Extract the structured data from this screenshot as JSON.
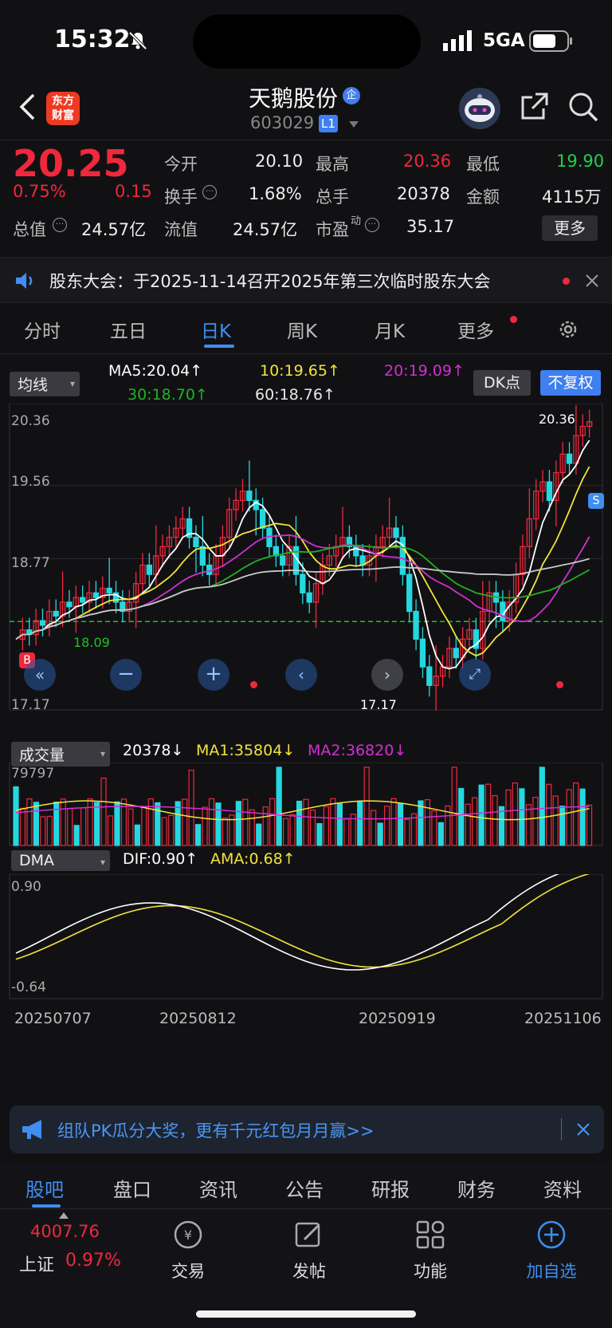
{
  "status_bar": {
    "time": "15:32",
    "network": "5GA"
  },
  "header": {
    "logo_line1": "东方",
    "logo_line2": "财富",
    "stock_name": "天鹅股份",
    "name_badge": "企",
    "stock_code": "603029",
    "level": "L1"
  },
  "quote": {
    "price": "20.25",
    "change_pct": "0.75%",
    "change_amt": "0.15",
    "open_label": "今开",
    "open": "20.10",
    "high_label": "最高",
    "high": "20.36",
    "low_label": "最低",
    "low": "19.90",
    "turnover_label": "换手",
    "turnover": "1.68%",
    "volume_label": "总手",
    "volume": "20378",
    "amount_label": "金额",
    "amount": "4115万",
    "mktcap_label": "总值",
    "mktcap": "24.57亿",
    "float_label": "流值",
    "float_cap": "24.57亿",
    "pe_label": "市盈",
    "pe_sup": "动",
    "pe": "35.17",
    "more_button": "更多"
  },
  "notice": {
    "text": "股东大会：于2025-11-14召开2025年第三次临时股东大会"
  },
  "period_tabs": [
    "分时",
    "五日",
    "日K",
    "周K",
    "月K",
    "更多"
  ],
  "active_tab_index": 2,
  "indicators": {
    "main_select": "均线",
    "ma5": "MA5:20.04↑",
    "ma10": "10:19.65↑",
    "ma20": "20:19.09↑",
    "ma30": "30:18.70↑",
    "ma60": "60:18.76↑",
    "dk_button": "DK点",
    "fq_button": "不复权"
  },
  "colors": {
    "up": "#f0283c",
    "down": "#25d8e0",
    "ma5": "#ffffff",
    "ma10": "#f2e33c",
    "ma20": "#d22fd2",
    "ma30": "#22b022",
    "ma60": "#c8c8c8",
    "accent": "#3f8ef0"
  },
  "chart_data": [
    {
      "type": "candlestick",
      "title": "日K",
      "yticks": [
        "20.36",
        "19.56",
        "18.77",
        "17.17"
      ],
      "ylim": [
        17.17,
        20.36
      ],
      "max_label": "20.36",
      "min_label": "17.17",
      "cost_line_value": "18.09",
      "buy_marker": "B",
      "sell_marker": "S",
      "xticks": [
        "20250707",
        "20250812",
        "20250919",
        "20251106"
      ],
      "ma_legend": [
        "MA5:20.04↑",
        "10:19.65↑",
        "20:19.09↑",
        "30:18.70↑",
        "60:18.76↑"
      ]
    },
    {
      "type": "bar",
      "title": "成交量",
      "ymax_label": "79797",
      "series_labels": [
        "20378↓",
        "MA1:35804↓",
        "MA2:36820↓"
      ]
    },
    {
      "type": "line",
      "title": "DMA",
      "yticks": [
        "0.90",
        "-0.64"
      ],
      "series_labels": [
        "DIF:0.90↑",
        "AMA:0.68↑"
      ]
    }
  ],
  "volume_panel": {
    "select": "成交量",
    "vol": "20378↓",
    "ma1": "MA1:35804↓",
    "ma2": "MA2:36820↓",
    "max": "79797"
  },
  "dma_panel": {
    "select": "DMA",
    "dif": "DIF:0.90↑",
    "ama": "AMA:0.68↑",
    "top": "0.90",
    "bottom": "-0.64"
  },
  "xaxis": [
    "20250707",
    "20250812",
    "20250919",
    "20251106"
  ],
  "ad": {
    "text": "组队PK瓜分大奖，更有千元红包月月赢>>"
  },
  "bottom_tabs": [
    "股吧",
    "盘口",
    "资讯",
    "公告",
    "研报",
    "财务",
    "资料"
  ],
  "dock": {
    "index_value": "4007.76",
    "index_name": "上证",
    "index_change": "0.97%",
    "trade": "交易",
    "post": "发帖",
    "func": "功能",
    "add": "加自选"
  }
}
